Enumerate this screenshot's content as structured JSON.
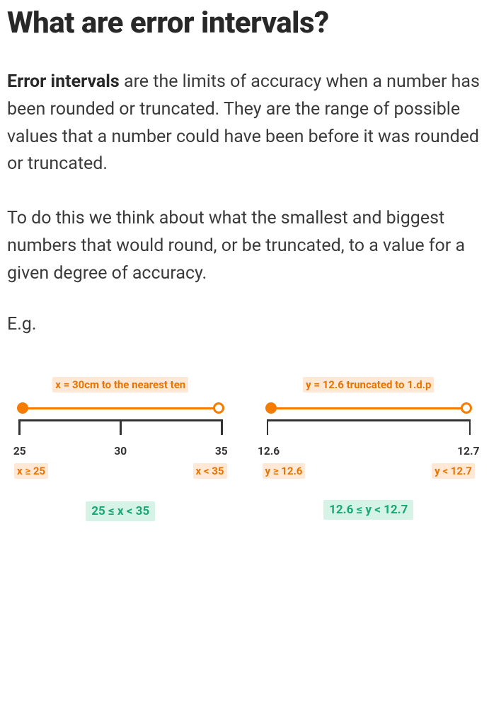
{
  "heading": "What are error intervals?",
  "intro_bold": "Error intervals",
  "intro_rest": " are the limits of accuracy when a number has been rounded or truncated. They are the range of possible values that a number could have been before it was rounded or truncated.",
  "para2": "To do this we think about what the smallest and biggest numbers that would round, or be truncated, to a value for a given degree of accuracy.",
  "eg_label": "E.g.",
  "diagrams": {
    "left": {
      "caption": "x = 30cm to the nearest ten",
      "ticks": {
        "a": "25",
        "b": "30",
        "c": "35"
      },
      "ineq_left": "x ≥ 25",
      "ineq_right": "x < 35",
      "combined": "25 ≤ x < 35"
    },
    "right": {
      "caption": "y = 12.6 truncated to 1.d.p",
      "ticks": {
        "a": "12.6",
        "c": "12.7"
      },
      "ineq_left": "y ≥ 12.6",
      "ineq_right": "y < 12.7",
      "combined": "12.6 ≤ y < 12.7"
    }
  },
  "chart_data": [
    {
      "type": "line",
      "title": "x = 30cm to the nearest ten",
      "x": [
        25,
        30,
        35
      ],
      "interval": {
        "lower": 25,
        "lower_inclusive": true,
        "upper": 35,
        "upper_inclusive": false
      },
      "inequality": "25 ≤ x < 35"
    },
    {
      "type": "line",
      "title": "y = 12.6 truncated to 1.d.p",
      "x": [
        12.6,
        12.7
      ],
      "interval": {
        "lower": 12.6,
        "lower_inclusive": true,
        "upper": 12.7,
        "upper_inclusive": false
      },
      "inequality": "12.6 ≤ y < 12.7"
    }
  ]
}
